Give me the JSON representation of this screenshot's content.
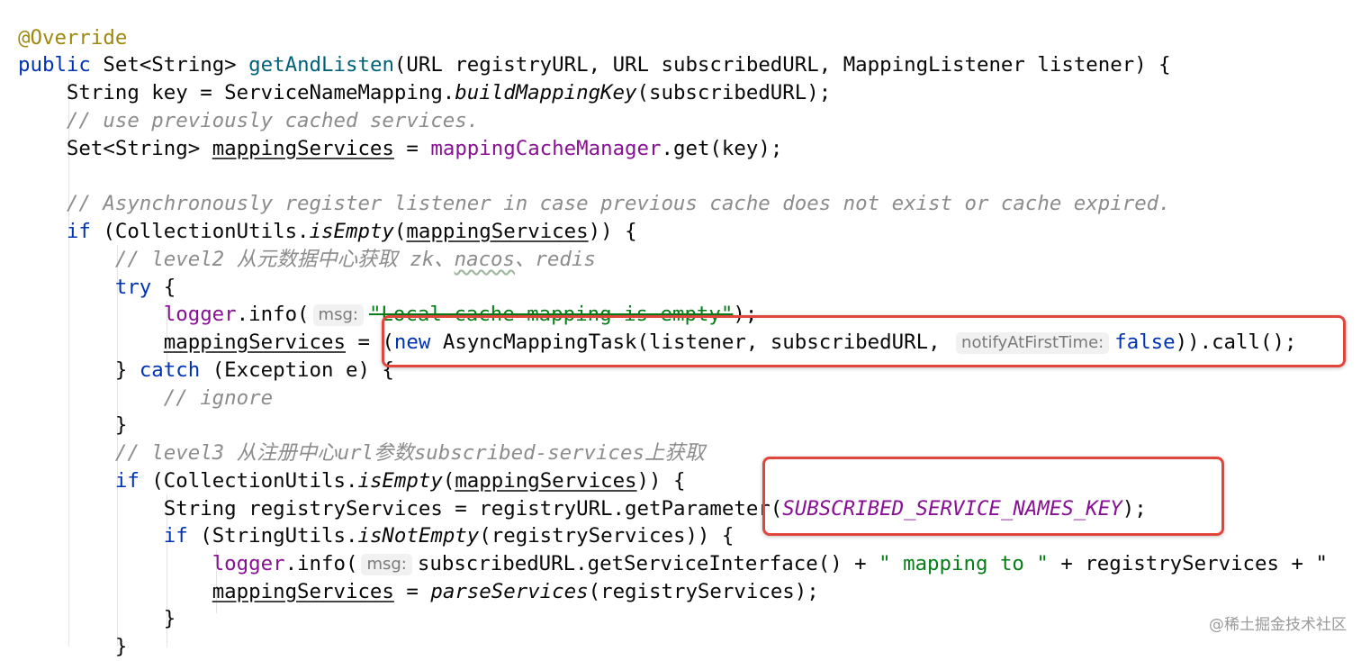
{
  "code": {
    "annotation": "@Override",
    "kw_public": "public",
    "ret_type": "Set<String>",
    "method_name": "getAndListen",
    "params": "(URL registryURL, URL subscribedURL, MappingListener listener) {",
    "l3_prefix": "String key = ServiceNameMapping.",
    "l3_call": "buildMappingKey",
    "l3_suffix": "(subscribedURL);",
    "l4_comment": "// use previously cached services.",
    "l5_prefix": "Set<String> ",
    "var_mapping_services": "mappingServices",
    "l5_eq": " = ",
    "l5_field": "mappingCacheManager",
    "l5_suffix": ".get(key);",
    "l7_comment": "// Asynchronously register listener in case previous cache does not exist or cache expired.",
    "kw_if": "if",
    "l8_prefix": " (CollectionUtils.",
    "l8_call": "isEmpty",
    "l8_open": "(",
    "l8_close": ")) {",
    "l9_comment_a": "// level2 从元数据中心获取 zk、",
    "l9_comment_b": "nacos",
    "l9_comment_c": "、redis",
    "kw_try": "try",
    "l10_suffix": " {",
    "logger": "logger",
    "info_open": ".info(",
    "hint_msg": "msg:",
    "l11_string": "\"Local cache mapping is empty\"",
    "l11_close": ");",
    "l12_eq": " = ",
    "l12_open": "(",
    "kw_new": "new",
    "l12_mid": " AsyncMappingTask(listener, subscribedURL, ",
    "hint_notify": "notifyAtFirstTime:",
    "kw_false": "false",
    "l12_close": ")).call();",
    "l13_brace": "} ",
    "kw_catch": "catch",
    "l13_suffix": " (Exception e) {",
    "l14_comment": "// ignore",
    "l15_brace": "}",
    "l16_comment": "// level3 从注册中心url参数subscribed-services上获取",
    "l18_prefix": "String registryServices = registryURL.getParameter(",
    "l18_const": "SUBSCRIBED_SERVICE_NAMES_KEY",
    "l18_close": ");",
    "l19_prefix": " (StringUtils.",
    "l19_call": "isNotEmpty",
    "l19_suffix": "(registryServices)) {",
    "l20_mid": "subscribedURL.getServiceInterface() + ",
    "l20_string": "\" mapping to \"",
    "l20_tail": " + registryServices + \"",
    "l21_eq": " = ",
    "l21_call": "parseServices",
    "l21_suffix": "(registryServices);",
    "l22_brace": "}",
    "l23_brace": "}"
  },
  "watermark": "@稀土掘金技术社区",
  "colors": {
    "keyword": "#0033b3",
    "annotation": "#9e880d",
    "method": "#00627a",
    "field": "#871094",
    "string": "#067d17",
    "comment": "#8c8c8c",
    "highlight_box": "#e0463c"
  }
}
